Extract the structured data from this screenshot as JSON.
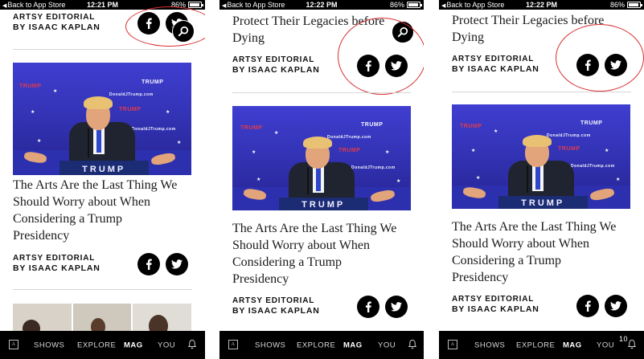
{
  "status_bar": {
    "back_label": "Back to App Store",
    "battery": "86%",
    "battery_level": 0.86,
    "times": [
      "12:21 PM",
      "12:22 PM",
      "12:22 PM"
    ]
  },
  "screens": [
    {
      "prev_byline": {
        "label": "ARTSY EDITORIAL",
        "author": "BY ISAAC KAPLAN"
      },
      "article": {
        "title_lines": [
          "The Arts Are the Last Thing We",
          "Should Worry about When",
          "Considering a Trump",
          "Presidency"
        ],
        "byline": {
          "label": "ARTSY EDITORIAL",
          "author": "BY ISAAC KAPLAN"
        }
      }
    },
    {
      "prev_title_lines": [
        "Protect Their Legacies before",
        "Dying"
      ],
      "prev_byline": {
        "label": "ARTSY EDITORIAL",
        "author": "BY ISAAC KAPLAN"
      },
      "article": {
        "title_lines": [
          "The Arts Are the Last Thing We",
          "Should Worry about When",
          "Considering a Trump",
          "Presidency"
        ],
        "byline": {
          "label": "ARTSY EDITORIAL",
          "author": "BY ISAAC KAPLAN"
        }
      }
    },
    {
      "prev_title_lines": [
        "Protect Their Legacies before",
        "Dying"
      ],
      "prev_byline": {
        "label": "ARTSY EDITORIAL",
        "author": "BY ISAAC KAPLAN"
      },
      "article": {
        "title_lines": [
          "The Arts Are the Last Thing We",
          "Should Worry about When",
          "Considering a Trump",
          "Presidency"
        ],
        "byline": {
          "label": "ARTSY EDITORIAL",
          "author": "BY ISAAC KAPLAN"
        }
      }
    }
  ],
  "photo": {
    "banner_words": [
      "TRUMP",
      "TRUMP",
      "DonaldJTrump.com",
      "DonaldJTrump.com",
      "TRUMP"
    ],
    "podium_text": "TRUMP"
  },
  "nav": {
    "items": [
      "SHOWS",
      "EXPLORE",
      "MAG",
      "YOU"
    ],
    "active": "MAG",
    "notification_count": "10"
  },
  "icons": {
    "facebook": "facebook-icon",
    "twitter": "twitter-icon",
    "search": "search-icon",
    "bell": "bell-icon",
    "logo": "artsy-logo-icon"
  },
  "colors": {
    "annotation_circle": "#d93030",
    "bar": "#000000",
    "photo_blue": "#3434b8"
  }
}
